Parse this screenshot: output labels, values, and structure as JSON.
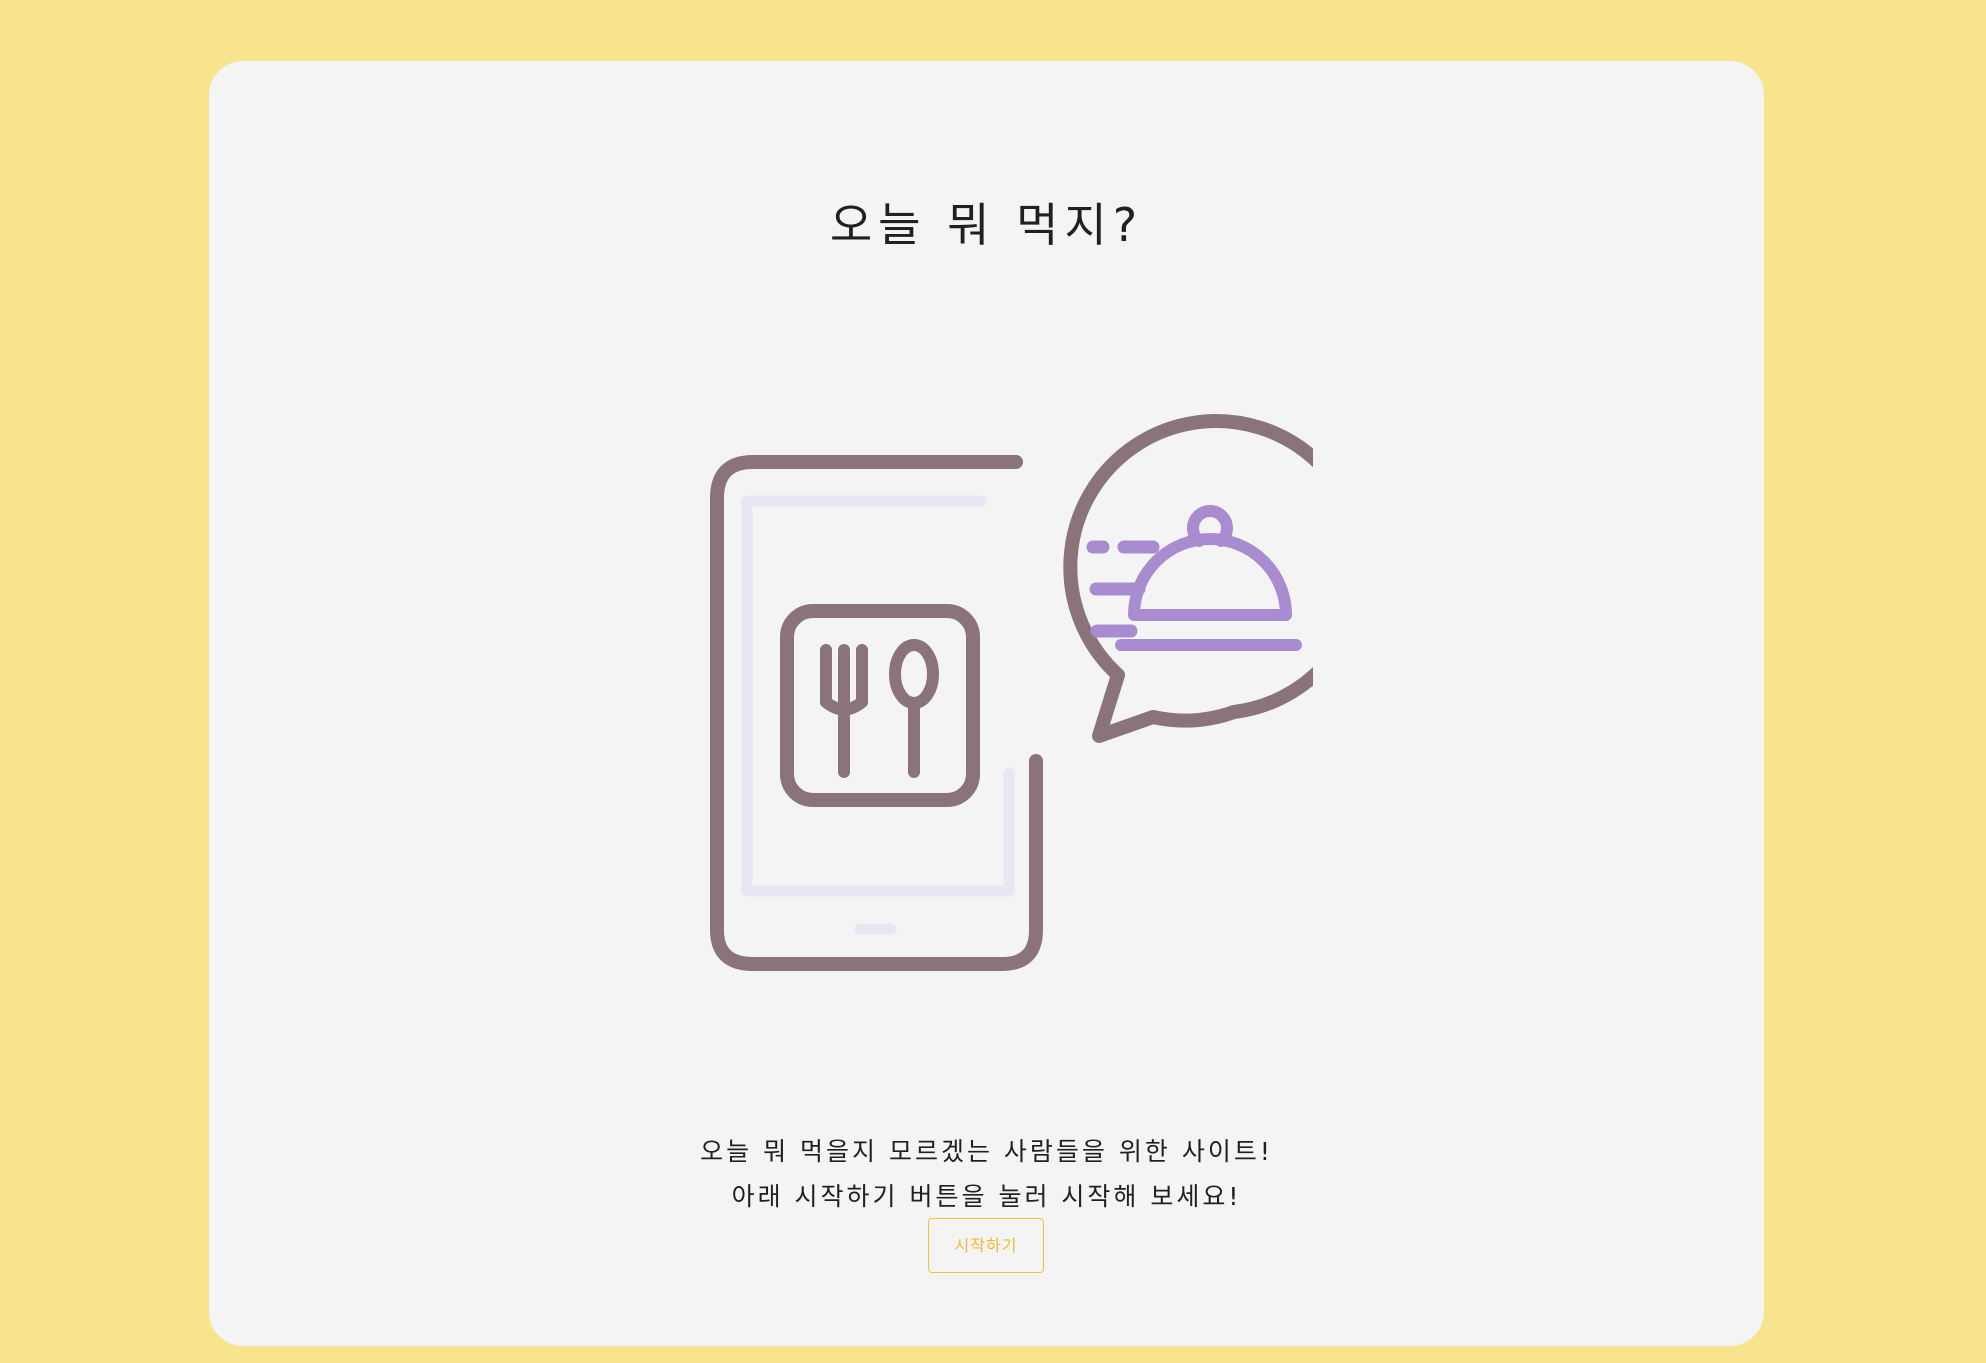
{
  "page": {
    "title": "오늘 뭐 먹지?",
    "description_line1": "오늘 뭐 먹을지 모르겠는 사람들을 위한 사이트!",
    "description_line2": "아래 시작하기 버튼을 눌러 시작해 보세요!",
    "start_button_label": "시작하기"
  },
  "illustration": {
    "icon": "food-delivery-app-icon",
    "parts": [
      "phone-icon",
      "fork-icon",
      "spoon-icon",
      "speech-bubble-icon",
      "cloche-icon"
    ]
  },
  "colors": {
    "background": "#f8e48c",
    "card": "#f4f4f5",
    "outline": "#8b7479",
    "accent_purple": "#a98ccf",
    "screen_tint": "#e9e6f1",
    "button": "#f1c232"
  }
}
